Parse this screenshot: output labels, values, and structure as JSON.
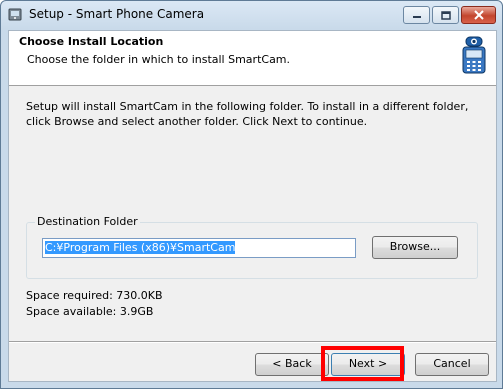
{
  "window": {
    "title": "Setup - Smart Phone Camera"
  },
  "header": {
    "title": "Choose Install Location",
    "subtitle": "Choose the folder in which to install SmartCam.",
    "icon": "phone-camera-icon"
  },
  "intro_text": "Setup will install SmartCam in the following folder. To install in a different folder, click Browse and select another folder. Click Next to continue.",
  "destination": {
    "label": "Destination Folder",
    "path": "C:¥Program Files (x86)¥SmartCam",
    "browse_label": "Browse..."
  },
  "space": {
    "required": "Space required: 730.0KB",
    "available": "Space available: 3.9GB"
  },
  "buttons": {
    "back": "< Back",
    "next": "Next >",
    "cancel": "Cancel"
  },
  "colors": {
    "highlight": "#ff0000",
    "selection": "#3399ff"
  }
}
